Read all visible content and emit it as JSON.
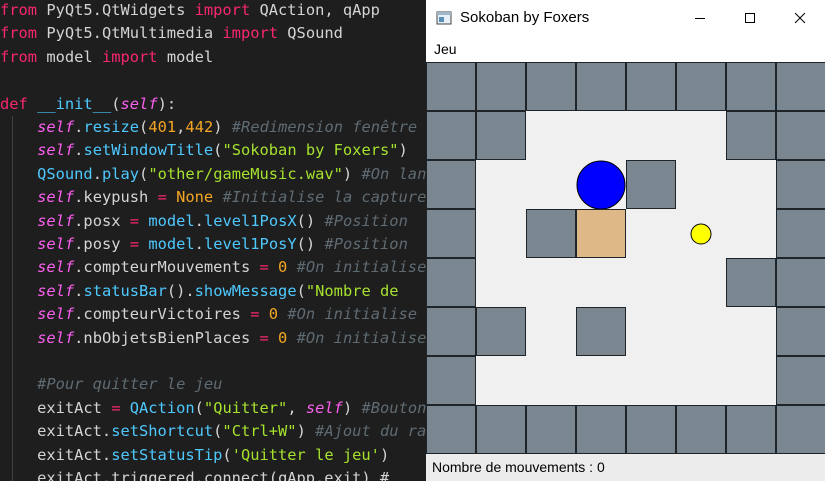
{
  "editor": {
    "lines": [
      [
        [
          "t-kw",
          "from"
        ],
        [
          "t-plain",
          " PyQt5.QtWidgets "
        ],
        [
          "t-kw",
          "import"
        ],
        [
          "t-plain",
          " QAction, qApp"
        ]
      ],
      [
        [
          "t-kw",
          "from"
        ],
        [
          "t-plain",
          " PyQt5.QtMultimedia "
        ],
        [
          "t-kw",
          "import"
        ],
        [
          "t-plain",
          " QSound"
        ]
      ],
      [
        [
          "t-kw",
          "from"
        ],
        [
          "t-plain",
          " model "
        ],
        [
          "t-kw",
          "import"
        ],
        [
          "t-plain",
          " model"
        ]
      ],
      [],
      [
        [
          "t-kw",
          "def"
        ],
        [
          "t-plain",
          " "
        ],
        [
          "t-fn",
          "__init__"
        ],
        [
          "t-plain",
          "("
        ],
        [
          "t-self",
          "self"
        ],
        [
          "t-plain",
          "):"
        ]
      ],
      [
        [
          "t-plain",
          "    "
        ],
        [
          "t-self",
          "self"
        ],
        [
          "t-plain",
          "."
        ],
        [
          "t-fn",
          "resize"
        ],
        [
          "t-plain",
          "("
        ],
        [
          "t-num",
          "401"
        ],
        [
          "t-plain",
          ","
        ],
        [
          "t-num",
          "442"
        ],
        [
          "t-plain",
          ") "
        ],
        [
          "t-cm",
          "#Redimension fenêtre"
        ]
      ],
      [
        [
          "t-plain",
          "    "
        ],
        [
          "t-self",
          "self"
        ],
        [
          "t-plain",
          "."
        ],
        [
          "t-fn",
          "setWindowTitle"
        ],
        [
          "t-plain",
          "("
        ],
        [
          "t-str",
          "\"Sokoban by Foxers\""
        ],
        [
          "t-plain",
          ")"
        ]
      ],
      [
        [
          "t-plain",
          "    "
        ],
        [
          "t-fn",
          "QSound"
        ],
        [
          "t-plain",
          "."
        ],
        [
          "t-fn",
          "play"
        ],
        [
          "t-plain",
          "("
        ],
        [
          "t-str",
          "\"other/gameMusic.wav\""
        ],
        [
          "t-plain",
          ") "
        ],
        [
          "t-cm",
          "#On lance la musique"
        ]
      ],
      [
        [
          "t-plain",
          "    "
        ],
        [
          "t-self",
          "self"
        ],
        [
          "t-plain",
          ".keypush "
        ],
        [
          "t-kw",
          "="
        ],
        [
          "t-plain",
          " "
        ],
        [
          "t-num",
          "None"
        ],
        [
          "t-plain",
          " "
        ],
        [
          "t-cm",
          "#Initialise la capture"
        ]
      ],
      [
        [
          "t-plain",
          "    "
        ],
        [
          "t-self",
          "self"
        ],
        [
          "t-plain",
          ".posx "
        ],
        [
          "t-kw",
          "="
        ],
        [
          "t-plain",
          " "
        ],
        [
          "t-fn",
          "model"
        ],
        [
          "t-plain",
          "."
        ],
        [
          "t-fn",
          "level1PosX"
        ],
        [
          "t-plain",
          "() "
        ],
        [
          "t-cm",
          "#Position"
        ]
      ],
      [
        [
          "t-plain",
          "    "
        ],
        [
          "t-self",
          "self"
        ],
        [
          "t-plain",
          ".posy "
        ],
        [
          "t-kw",
          "="
        ],
        [
          "t-plain",
          " "
        ],
        [
          "t-fn",
          "model"
        ],
        [
          "t-plain",
          "."
        ],
        [
          "t-fn",
          "level1PosY"
        ],
        [
          "t-plain",
          "() "
        ],
        [
          "t-cm",
          "#Position"
        ]
      ],
      [
        [
          "t-plain",
          "    "
        ],
        [
          "t-self",
          "self"
        ],
        [
          "t-plain",
          ".compteurMouvements "
        ],
        [
          "t-kw",
          "="
        ],
        [
          "t-plain",
          " "
        ],
        [
          "t-num",
          "0"
        ],
        [
          "t-plain",
          " "
        ],
        [
          "t-cm",
          "#On initialise"
        ]
      ],
      [
        [
          "t-plain",
          "    "
        ],
        [
          "t-self",
          "self"
        ],
        [
          "t-plain",
          "."
        ],
        [
          "t-fn",
          "statusBar"
        ],
        [
          "t-plain",
          "()."
        ],
        [
          "t-fn",
          "showMessage"
        ],
        [
          "t-plain",
          "("
        ],
        [
          "t-str",
          "\"Nombre de"
        ]
      ],
      [
        [
          "t-plain",
          "    "
        ],
        [
          "t-self",
          "self"
        ],
        [
          "t-plain",
          ".compteurVictoires "
        ],
        [
          "t-kw",
          "="
        ],
        [
          "t-plain",
          " "
        ],
        [
          "t-num",
          "0"
        ],
        [
          "t-plain",
          " "
        ],
        [
          "t-cm",
          "#On initialise"
        ]
      ],
      [
        [
          "t-plain",
          "    "
        ],
        [
          "t-self",
          "self"
        ],
        [
          "t-plain",
          ".nbObjetsBienPlaces "
        ],
        [
          "t-kw",
          "="
        ],
        [
          "t-plain",
          " "
        ],
        [
          "t-num",
          "0"
        ],
        [
          "t-plain",
          " "
        ],
        [
          "t-cm",
          "#On initialise"
        ]
      ],
      [],
      [
        [
          "t-plain",
          "    "
        ],
        [
          "t-cm",
          "#Pour quitter le jeu"
        ]
      ],
      [
        [
          "t-plain",
          "    exitAct "
        ],
        [
          "t-kw",
          "="
        ],
        [
          "t-plain",
          " "
        ],
        [
          "t-fn",
          "QAction"
        ],
        [
          "t-plain",
          "("
        ],
        [
          "t-str",
          "\"Quitter\""
        ],
        [
          "t-plain",
          ", "
        ],
        [
          "t-self",
          "self"
        ],
        [
          "t-plain",
          ") "
        ],
        [
          "t-cm",
          "#Bouton"
        ]
      ],
      [
        [
          "t-plain",
          "    exitAct."
        ],
        [
          "t-fn",
          "setShortcut"
        ],
        [
          "t-plain",
          "("
        ],
        [
          "t-str",
          "\"Ctrl+W\""
        ],
        [
          "t-plain",
          ") "
        ],
        [
          "t-cm",
          "#Ajout du raccourci"
        ]
      ],
      [
        [
          "t-plain",
          "    exitAct."
        ],
        [
          "t-fn",
          "setStatusTip"
        ],
        [
          "t-plain",
          "("
        ],
        [
          "t-str",
          "'Quitter le jeu'"
        ],
        [
          "t-plain",
          ")"
        ]
      ],
      [
        [
          "t-plain",
          "    exitAct.triggered.connect(qApp.exit) #"
        ]
      ]
    ]
  },
  "window": {
    "title": "Sokoban by Foxers",
    "menu_label": "Jeu",
    "status_message": "Nombre de mouvements : 0",
    "icons": {
      "app": "app-window-icon",
      "minimize": "minimize-icon",
      "maximize": "maximize-icon",
      "close": "close-icon"
    }
  },
  "board": {
    "columns": 8,
    "rows": 8,
    "legend": {
      "#": "wall",
      "$": "crate",
      ".": "floor",
      "@": "player",
      "+": "goal"
    },
    "map": [
      "########",
      "##....##",
      "#..@#..#",
      "#.#$.+.#",
      "#.....##",
      "##.#...#",
      "#......#",
      "########"
    ],
    "colors": {
      "wall": "#7a8790",
      "floor": "#f0f0f0",
      "crate": "#deb887",
      "player": "#0000ff",
      "goal": "#ffff00",
      "outline": "#1f2428"
    }
  }
}
